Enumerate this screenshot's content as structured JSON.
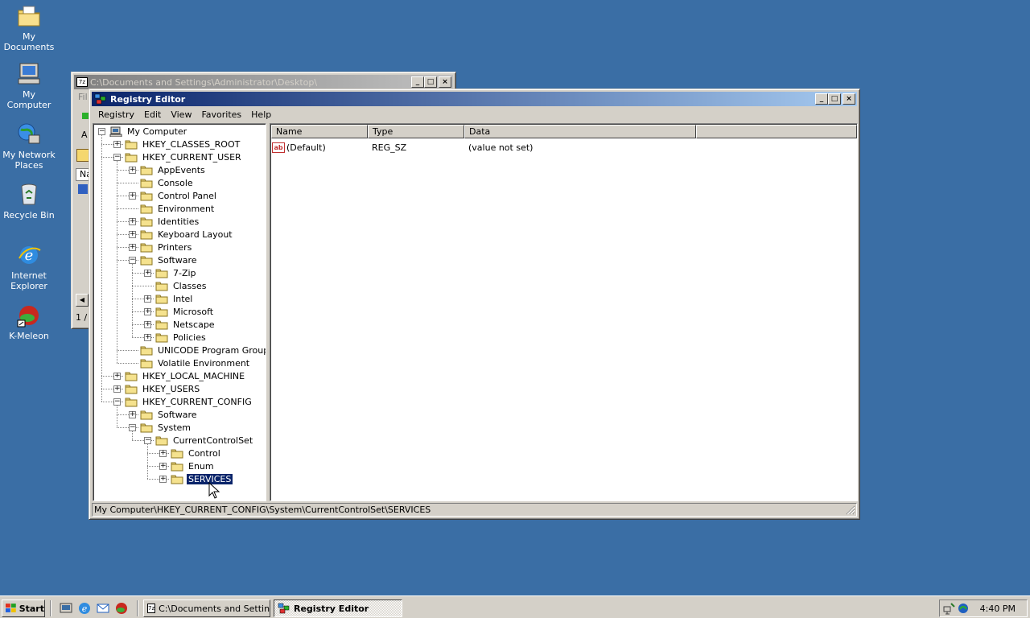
{
  "desktop": {
    "icons": [
      {
        "label": "My Documents",
        "icon": "my-documents-icon"
      },
      {
        "label": "My Computer",
        "icon": "my-computer-icon"
      },
      {
        "label": "My Network Places",
        "icon": "network-places-icon"
      },
      {
        "label": "Recycle Bin",
        "icon": "recycle-bin-icon"
      },
      {
        "label": "Internet Explorer",
        "icon": "internet-explorer-icon"
      },
      {
        "label": "K-Meleon",
        "icon": "k-meleon-icon"
      }
    ]
  },
  "bg_window": {
    "title": "C:\\Documents and Settings\\Administrator\\Desktop\\",
    "menu_partial": "Fil",
    "addr_partial": "A",
    "col_partial": "Na",
    "status_partial": "1 /"
  },
  "regedit": {
    "title": "Registry Editor",
    "menu": [
      "Registry",
      "Edit",
      "View",
      "Favorites",
      "Help"
    ],
    "tree": [
      {
        "label": "My Computer",
        "level": 0,
        "exp": "-"
      },
      {
        "label": "HKEY_CLASSES_ROOT",
        "level": 1,
        "exp": "+"
      },
      {
        "label": "HKEY_CURRENT_USER",
        "level": 1,
        "exp": "-"
      },
      {
        "label": "AppEvents",
        "level": 2,
        "exp": "+"
      },
      {
        "label": "Console",
        "level": 2,
        "exp": ""
      },
      {
        "label": "Control Panel",
        "level": 2,
        "exp": "+"
      },
      {
        "label": "Environment",
        "level": 2,
        "exp": ""
      },
      {
        "label": "Identities",
        "level": 2,
        "exp": "+"
      },
      {
        "label": "Keyboard Layout",
        "level": 2,
        "exp": "+"
      },
      {
        "label": "Printers",
        "level": 2,
        "exp": "+"
      },
      {
        "label": "Software",
        "level": 2,
        "exp": "-"
      },
      {
        "label": "7-Zip",
        "level": 3,
        "exp": "+"
      },
      {
        "label": "Classes",
        "level": 3,
        "exp": ""
      },
      {
        "label": "Intel",
        "level": 3,
        "exp": "+"
      },
      {
        "label": "Microsoft",
        "level": 3,
        "exp": "+"
      },
      {
        "label": "Netscape",
        "level": 3,
        "exp": "+"
      },
      {
        "label": "Policies",
        "level": 3,
        "exp": "+"
      },
      {
        "label": "UNICODE Program Groups",
        "level": 2,
        "exp": ""
      },
      {
        "label": "Volatile Environment",
        "level": 2,
        "exp": ""
      },
      {
        "label": "HKEY_LOCAL_MACHINE",
        "level": 1,
        "exp": "+"
      },
      {
        "label": "HKEY_USERS",
        "level": 1,
        "exp": "+"
      },
      {
        "label": "HKEY_CURRENT_CONFIG",
        "level": 1,
        "exp": "-"
      },
      {
        "label": "Software",
        "level": 2,
        "exp": "+"
      },
      {
        "label": "System",
        "level": 2,
        "exp": "-"
      },
      {
        "label": "CurrentControlSet",
        "level": 3,
        "exp": "-"
      },
      {
        "label": "Control",
        "level": 4,
        "exp": "+"
      },
      {
        "label": "Enum",
        "level": 4,
        "exp": "+"
      },
      {
        "label": "SERVICES",
        "level": 4,
        "exp": "+",
        "selected": true
      }
    ],
    "columns": [
      "Name",
      "Type",
      "Data"
    ],
    "values": [
      {
        "name": "(Default)",
        "type": "REG_SZ",
        "data": "(value not set)"
      }
    ],
    "status": "My Computer\\HKEY_CURRENT_CONFIG\\System\\CurrentControlSet\\SERVICES"
  },
  "taskbar": {
    "start_label": "Start",
    "tasks": [
      {
        "label": "C:\\Documents and Settin...",
        "pressed": false
      },
      {
        "label": "Registry Editor",
        "pressed": true
      }
    ],
    "clock": "4:40 PM"
  },
  "colors": {
    "desktop": "#3a6ea5",
    "title_active": "#0a246a",
    "face": "#d4d0c8"
  }
}
